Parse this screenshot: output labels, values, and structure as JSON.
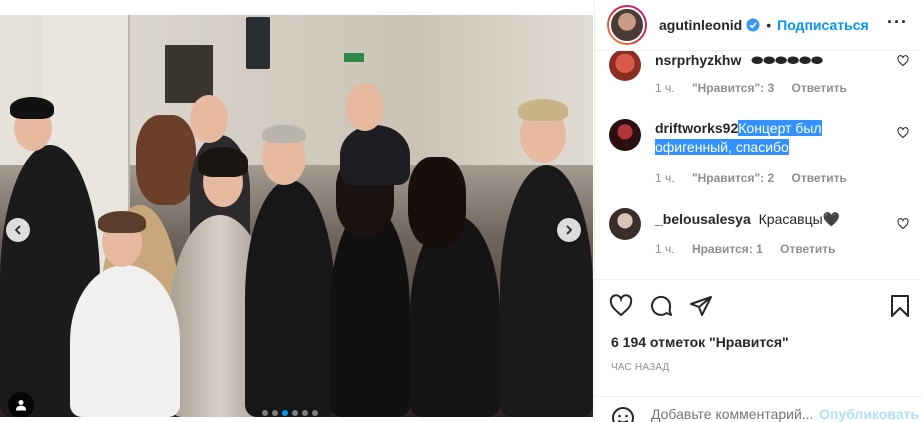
{
  "post": {
    "username": "agutinleonid",
    "follow_label": "Подписаться",
    "separator": "•",
    "more_label": "···",
    "likes": "6 194 отметок \"Нравится\"",
    "time": "ЧАС НАЗАД",
    "carousel": {
      "count": 6,
      "active_index": 2
    }
  },
  "comments": [
    {
      "user": "nsrprhyzkhw",
      "text": "⬬⬬⬬⬬⬬⬬",
      "time": "1 ч.",
      "likes": "\"Нравится\": 3",
      "reply": "Ответить"
    },
    {
      "user": "driftworks92",
      "text": "Концерт был офигенный, спасибо",
      "time": "1 ч.",
      "likes": "\"Нравится\": 2",
      "reply": "Ответить"
    },
    {
      "user": "_belousalesya",
      "text": "Красавцы🖤",
      "time": "1 ч.",
      "likes": "Нравится: 1",
      "reply": "Ответить"
    }
  ],
  "add_comment": {
    "placeholder": "Добавьте комментарий...",
    "publish_label": "Опубликовать"
  },
  "colors": {
    "accent": "#0095f6",
    "muted": "#8e8e8e",
    "text": "#262626",
    "highlight": "#3390ff"
  }
}
